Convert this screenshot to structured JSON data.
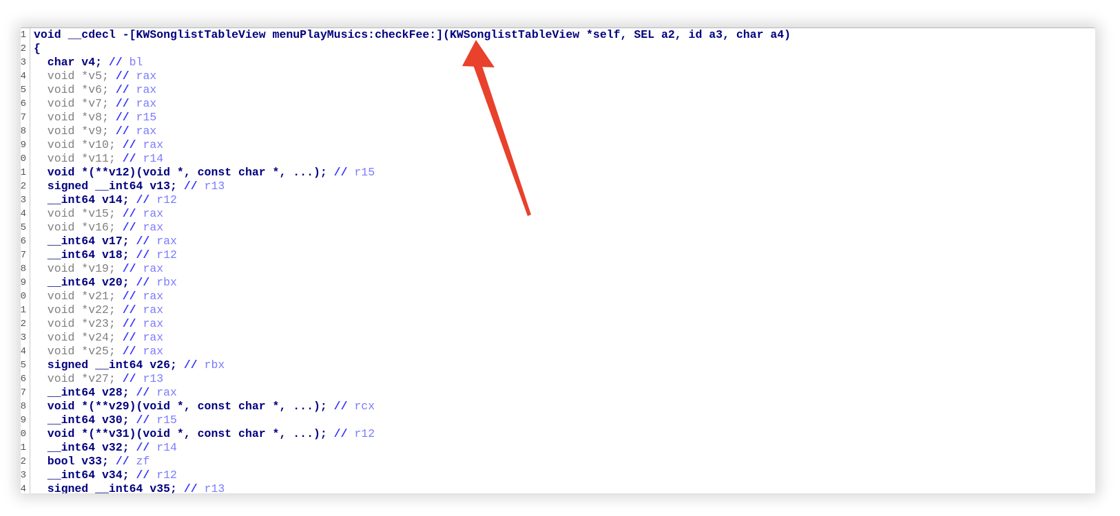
{
  "editor": {
    "lines": [
      {
        "num": "1",
        "code": "void __cdecl -[KWSonglistTableView menuPlayMusics:checkFee:](KWSonglistTableView *self, SEL a2, id a3, char a4)",
        "style": "decl",
        "comment": "",
        "reg": ""
      },
      {
        "num": "2",
        "code": "{",
        "style": "decl",
        "comment": "",
        "reg": ""
      },
      {
        "num": "3",
        "code": "  char v4; ",
        "style": "decl",
        "comment": "//",
        "reg": " bl"
      },
      {
        "num": "4",
        "code": "  void *v5; ",
        "style": "dim",
        "comment": "//",
        "reg": " rax"
      },
      {
        "num": "5",
        "code": "  void *v6; ",
        "style": "dim",
        "comment": "//",
        "reg": " rax"
      },
      {
        "num": "6",
        "code": "  void *v7; ",
        "style": "dim",
        "comment": "//",
        "reg": " rax"
      },
      {
        "num": "7",
        "code": "  void *v8; ",
        "style": "dim",
        "comment": "//",
        "reg": " r15"
      },
      {
        "num": "8",
        "code": "  void *v9; ",
        "style": "dim",
        "comment": "//",
        "reg": " rax"
      },
      {
        "num": "9",
        "code": "  void *v10; ",
        "style": "dim",
        "comment": "//",
        "reg": " rax"
      },
      {
        "num": "0",
        "code": "  void *v11; ",
        "style": "dim",
        "comment": "//",
        "reg": " r14"
      },
      {
        "num": "1",
        "code": "  void *(**v12)(void *, const char *, ...); ",
        "style": "decl",
        "comment": "//",
        "reg": " r15"
      },
      {
        "num": "2",
        "code": "  signed __int64 v13; ",
        "style": "decl",
        "comment": "//",
        "reg": " r13"
      },
      {
        "num": "3",
        "code": "  __int64 v14; ",
        "style": "decl",
        "comment": "//",
        "reg": " r12"
      },
      {
        "num": "4",
        "code": "  void *v15; ",
        "style": "dim",
        "comment": "//",
        "reg": " rax"
      },
      {
        "num": "5",
        "code": "  void *v16; ",
        "style": "dim",
        "comment": "//",
        "reg": " rax"
      },
      {
        "num": "6",
        "code": "  __int64 v17; ",
        "style": "decl",
        "comment": "//",
        "reg": " rax"
      },
      {
        "num": "7",
        "code": "  __int64 v18; ",
        "style": "decl",
        "comment": "//",
        "reg": " r12"
      },
      {
        "num": "8",
        "code": "  void *v19; ",
        "style": "dim",
        "comment": "//",
        "reg": " rax"
      },
      {
        "num": "9",
        "code": "  __int64 v20; ",
        "style": "decl",
        "comment": "//",
        "reg": " rbx"
      },
      {
        "num": "0",
        "code": "  void *v21; ",
        "style": "dim",
        "comment": "//",
        "reg": " rax"
      },
      {
        "num": "1",
        "code": "  void *v22; ",
        "style": "dim",
        "comment": "//",
        "reg": " rax"
      },
      {
        "num": "2",
        "code": "  void *v23; ",
        "style": "dim",
        "comment": "//",
        "reg": " rax"
      },
      {
        "num": "3",
        "code": "  void *v24; ",
        "style": "dim",
        "comment": "//",
        "reg": " rax"
      },
      {
        "num": "4",
        "code": "  void *v25; ",
        "style": "dim",
        "comment": "//",
        "reg": " rax"
      },
      {
        "num": "5",
        "code": "  signed __int64 v26; ",
        "style": "decl",
        "comment": "//",
        "reg": " rbx"
      },
      {
        "num": "6",
        "code": "  void *v27; ",
        "style": "dim",
        "comment": "//",
        "reg": " r13"
      },
      {
        "num": "7",
        "code": "  __int64 v28; ",
        "style": "decl",
        "comment": "//",
        "reg": " rax"
      },
      {
        "num": "8",
        "code": "  void *(**v29)(void *, const char *, ...); ",
        "style": "decl",
        "comment": "//",
        "reg": " rcx"
      },
      {
        "num": "9",
        "code": "  __int64 v30; ",
        "style": "decl",
        "comment": "//",
        "reg": " r15"
      },
      {
        "num": "0",
        "code": "  void *(**v31)(void *, const char *, ...); ",
        "style": "decl",
        "comment": "//",
        "reg": " r12"
      },
      {
        "num": "1",
        "code": "  __int64 v32; ",
        "style": "decl",
        "comment": "//",
        "reg": " r14"
      },
      {
        "num": "2",
        "code": "  bool v33; ",
        "style": "decl",
        "comment": "//",
        "reg": " zf"
      },
      {
        "num": "3",
        "code": "  __int64 v34; ",
        "style": "decl",
        "comment": "//",
        "reg": " r12"
      },
      {
        "num": "4",
        "code": "  signed __int64 v35; ",
        "style": "decl",
        "comment": "//",
        "reg": " r13"
      }
    ]
  },
  "annotation": {
    "arrow_color": "#e8412c",
    "arrow_icon": "red-arrow-icon"
  },
  "colors": {
    "declaration": "#000080",
    "dimmed": "#808080",
    "comment": "#3333ff",
    "register": "#7b7bff"
  }
}
